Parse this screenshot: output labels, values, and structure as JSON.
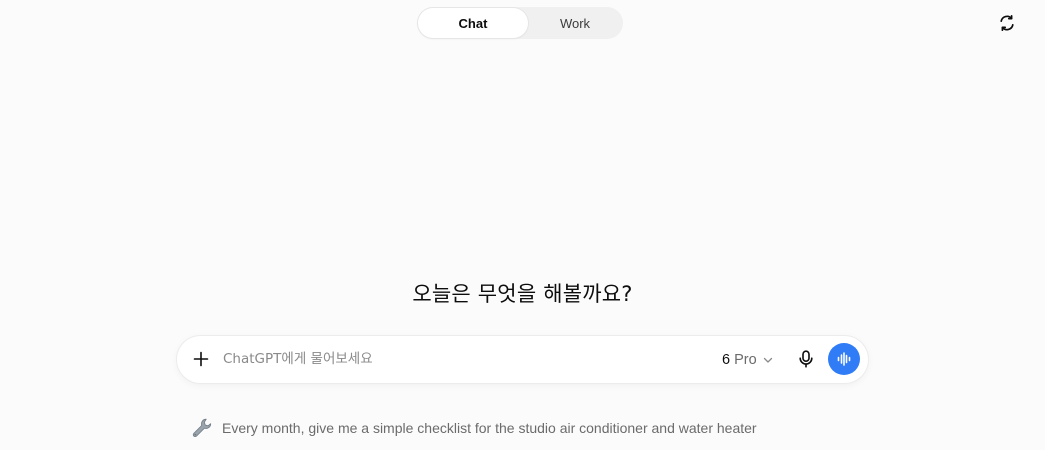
{
  "mode_toggle": {
    "tabs": [
      {
        "label": "Chat",
        "active": true
      },
      {
        "label": "Work",
        "active": false
      }
    ]
  },
  "top_right": {
    "icon": "refresh-icon"
  },
  "headline": "오늘은 무엇을 해볼까요?",
  "composer": {
    "plus_icon": "plus-icon",
    "placeholder": "ChatGPT에게 물어보세요",
    "value": "",
    "model": {
      "version": "6",
      "name": "Pro",
      "icon": "chevron-down-icon"
    },
    "mic_icon": "microphone-icon",
    "voice_icon": "voice-waveform-icon",
    "accent_color": "#2f7cf6"
  },
  "suggestion": {
    "icon": "wrench-icon",
    "text": "Every month, give me a simple checklist for the studio air conditioner and water heater"
  }
}
